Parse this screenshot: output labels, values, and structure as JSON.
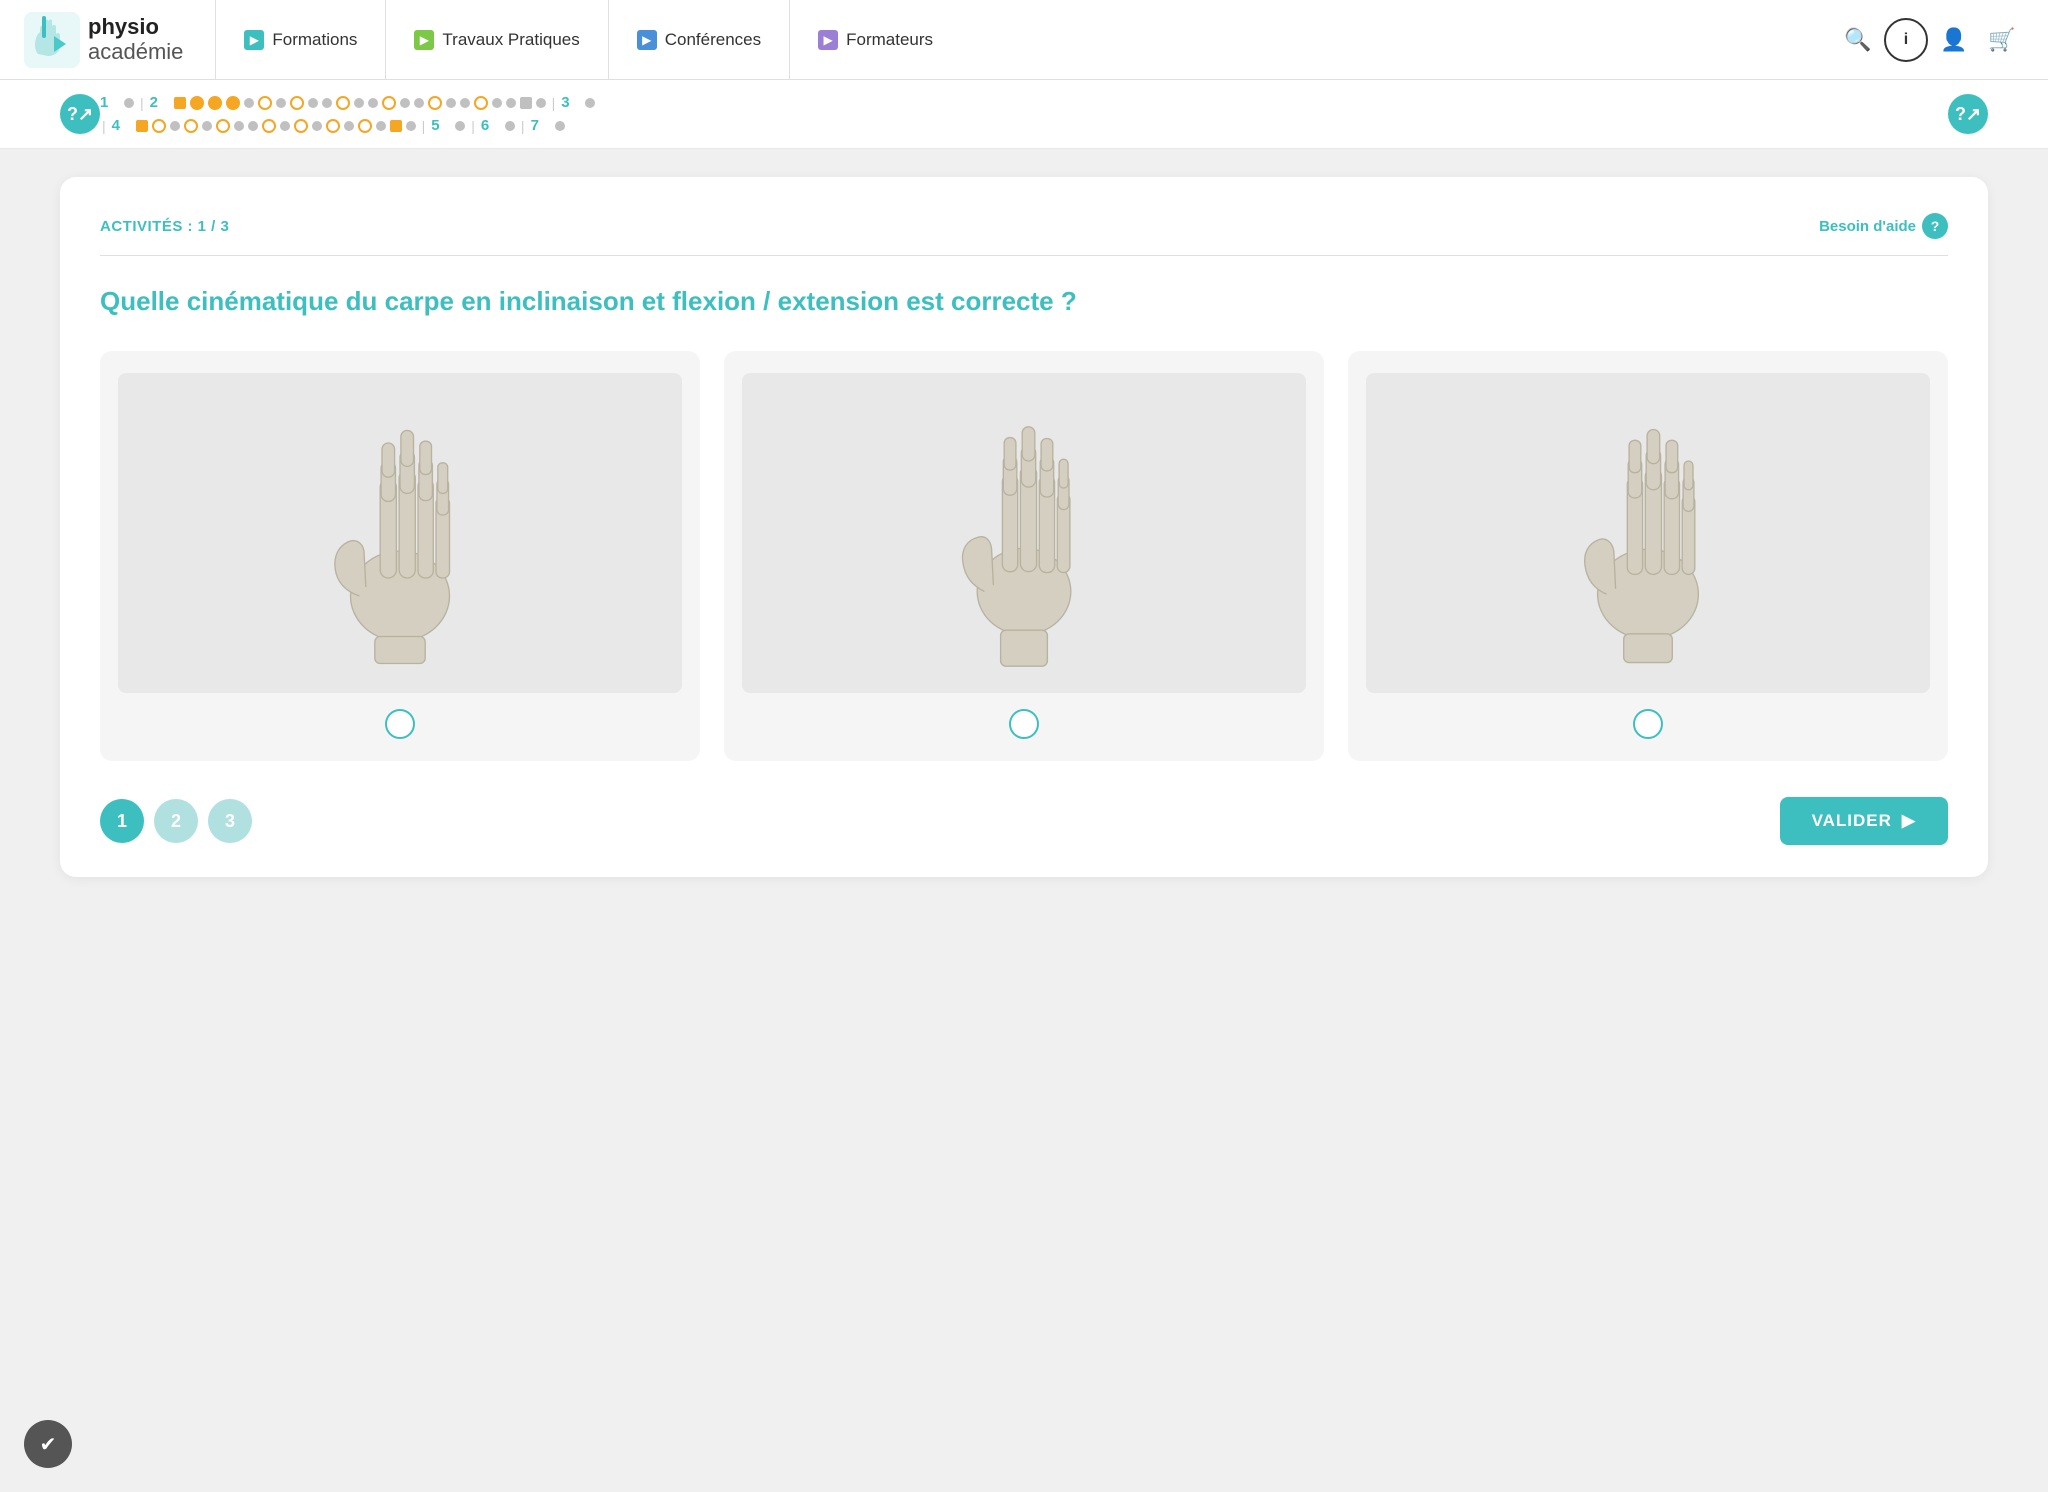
{
  "nav": {
    "logo": {
      "physio": "physio",
      "academie": "académie"
    },
    "items": [
      {
        "id": "formations",
        "label": "Formations",
        "icon_color": "teal"
      },
      {
        "id": "travaux-pratiques",
        "label": "Travaux Pratiques",
        "icon_color": "green"
      },
      {
        "id": "conferences",
        "label": "Conférences",
        "icon_color": "blue"
      },
      {
        "id": "formateurs",
        "label": "Formateurs",
        "icon_color": "purple"
      }
    ],
    "actions": [
      "search",
      "info",
      "user",
      "cart"
    ]
  },
  "progress": {
    "sections": [
      {
        "label": "1"
      },
      {
        "label": "2"
      },
      {
        "label": "3"
      },
      {
        "label": "4"
      },
      {
        "label": "5"
      },
      {
        "label": "6"
      },
      {
        "label": "7"
      }
    ]
  },
  "quiz": {
    "activity_label": "ACTIVITÉS : 1 / 3",
    "help_text": "Besoin d'aide",
    "question": "Quelle cinématique du carpe en inclinaison et flexion / extension est correcte ?",
    "choices": [
      {
        "id": 1,
        "alt": "Main squelette vue 1"
      },
      {
        "id": 2,
        "alt": "Main squelette vue 2"
      },
      {
        "id": 3,
        "alt": "Main squelette vue 3"
      }
    ],
    "pages": [
      {
        "num": "1",
        "active": true
      },
      {
        "num": "2",
        "active": false
      },
      {
        "num": "3",
        "active": false
      }
    ],
    "validate_label": "VALIDER"
  }
}
